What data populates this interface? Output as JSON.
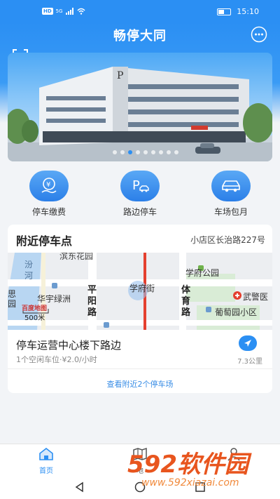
{
  "status_bar": {
    "network": "HD",
    "signal": "5G",
    "time": "15:10"
  },
  "header": {
    "title": "畅停大同",
    "scan_icon": "scan-icon",
    "more_icon": "more-icon"
  },
  "banner": {
    "slides": 9,
    "active_slide": 2
  },
  "quick_actions": [
    {
      "label": "停车缴费",
      "icon": "yuan-hand-icon"
    },
    {
      "label": "路边停车",
      "icon": "parking-car-icon"
    },
    {
      "label": "车场包月",
      "icon": "car-icon"
    }
  ],
  "nearby": {
    "title": "附近停车点",
    "address": "小店区长治路227号",
    "map_labels": {
      "binhe": "滨东花园",
      "fen": "汾",
      "he": "河",
      "xuefu_park": "学府公园",
      "si": "思",
      "yuan": "园",
      "huayu": "华宇绿洲",
      "pingyang_1": "平",
      "pingyang_2": "阳",
      "pingyang_3": "路",
      "xuefu_street": "学府街",
      "tiyu_1": "体",
      "tiyu_2": "育",
      "tiyu_3": "路",
      "wujing": "武警医",
      "putao": "葡萄园小区",
      "scale": "500米",
      "logo": "百度地图"
    },
    "lot": {
      "name": "停车运营中心楼下路边",
      "meta": "1个空闲车位·¥2.0/小时",
      "distance": "7.3公里"
    },
    "more_link": "查看附近2个停车场"
  },
  "tabs": [
    {
      "label": "首页",
      "active": true
    },
    {
      "label": "地"
    }
  ],
  "watermark": {
    "brand": "592软件园",
    "url": "www.592xiazai.com"
  },
  "colors": {
    "primary": "#2b8ff3",
    "watermark": "#e8551e"
  }
}
